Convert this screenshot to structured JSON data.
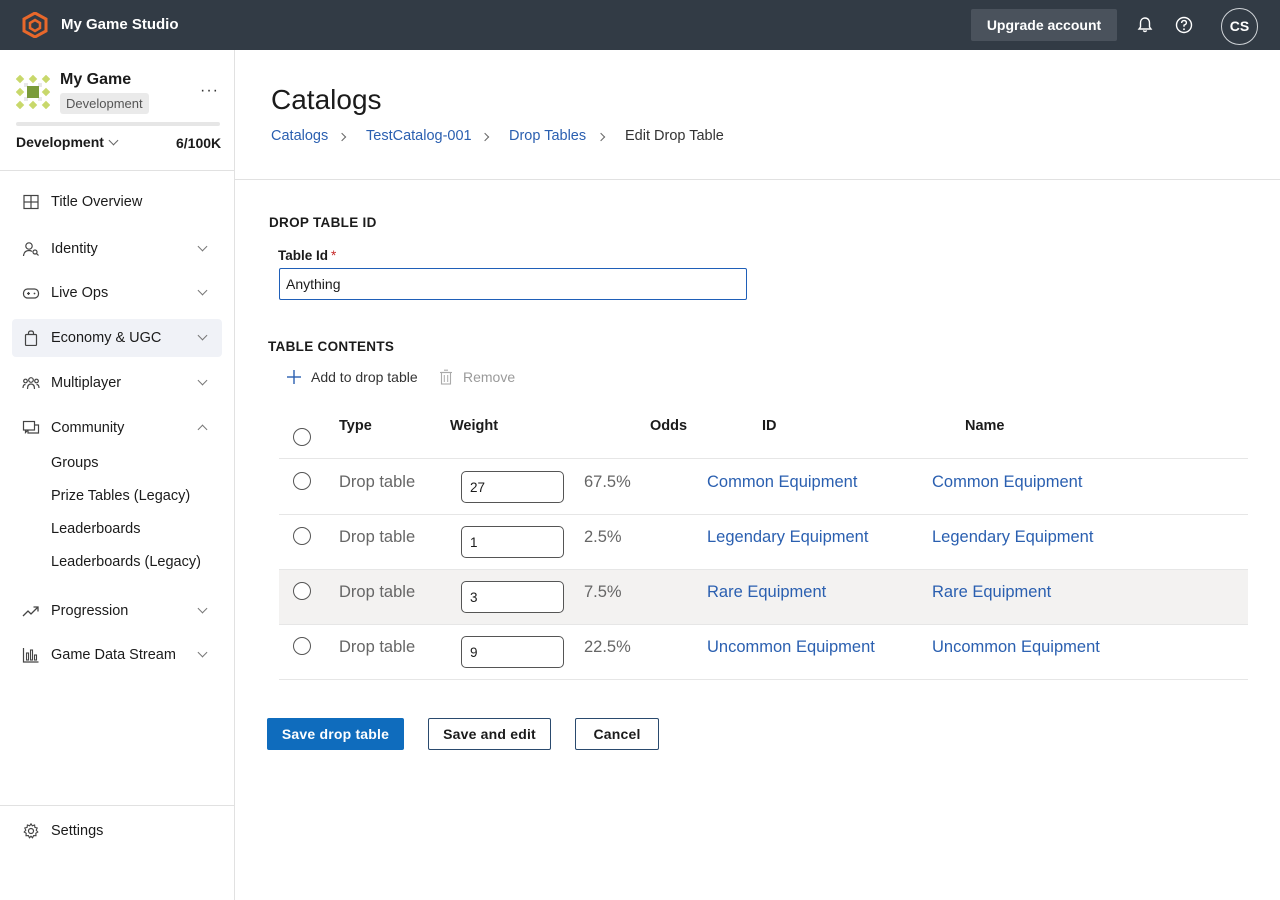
{
  "topbar": {
    "app_title": "My Game Studio",
    "upgrade_label": "Upgrade account",
    "avatar_initials": "CS"
  },
  "sidebar": {
    "game_name": "My Game",
    "environment_badge": "Development",
    "environment_select": "Development",
    "usage": "6/100K",
    "usage_fraction": 6e-05,
    "items": [
      {
        "label": "Title Overview",
        "icon": "grid-icon"
      },
      {
        "label": "Identity",
        "icon": "person-key-icon"
      },
      {
        "label": "Live Ops",
        "icon": "gamepad-icon"
      },
      {
        "label": "Economy & UGC",
        "icon": "shopping-bag-icon"
      },
      {
        "label": "Multiplayer",
        "icon": "people-icon"
      },
      {
        "label": "Community",
        "icon": "chat-icon"
      },
      {
        "label": "Progression",
        "icon": "trending-up-icon"
      },
      {
        "label": "Game Data Stream",
        "icon": "bar-chart-icon"
      }
    ],
    "community_subitems": [
      "Groups",
      "Prize Tables (Legacy)",
      "Leaderboards",
      "Leaderboards (Legacy)"
    ],
    "settings_label": "Settings"
  },
  "page": {
    "title": "Catalogs",
    "breadcrumbs": [
      "Catalogs",
      "TestCatalog-001",
      "Drop Tables",
      "Edit Drop Table"
    ]
  },
  "form": {
    "section_id_title": "DROP TABLE ID",
    "table_id_label": "Table Id",
    "required_mark": "*",
    "table_id_value": "Anything",
    "section_contents_title": "TABLE CONTENTS",
    "add_label": "Add to drop table",
    "remove_label": "Remove"
  },
  "table": {
    "headers": {
      "type": "Type",
      "weight": "Weight",
      "odds": "Odds",
      "id": "ID",
      "name": "Name"
    },
    "rows": [
      {
        "type": "Drop table",
        "weight": "27",
        "odds": "67.5%",
        "id": "Common Equipment",
        "name": "Common Equipment"
      },
      {
        "type": "Drop table",
        "weight": "1",
        "odds": "2.5%",
        "id": "Legendary Equipment",
        "name": "Legendary Equipment"
      },
      {
        "type": "Drop table",
        "weight": "3",
        "odds": "7.5%",
        "id": "Rare Equipment",
        "name": "Rare Equipment"
      },
      {
        "type": "Drop table",
        "weight": "9",
        "odds": "22.5%",
        "id": "Uncommon Equipment",
        "name": "Uncommon Equipment"
      }
    ]
  },
  "actions": {
    "save": "Save drop table",
    "save_edit": "Save and edit",
    "cancel": "Cancel"
  },
  "colors": {
    "topbar": "#323b45",
    "primary": "#0f6cbd",
    "link": "#2a5fb0",
    "logo": "#e8682b"
  }
}
